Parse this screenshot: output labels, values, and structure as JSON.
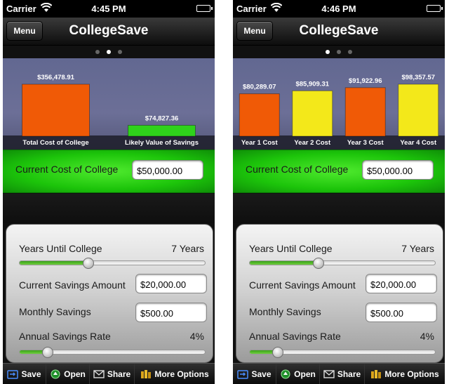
{
  "status": {
    "carrier": "Carrier"
  },
  "navbar": {
    "menu_label": "Menu",
    "title": "CollegeSave"
  },
  "cost_of_college": {
    "label": "Current Cost of College",
    "value": "$50,000.00"
  },
  "form": {
    "years_label": "Years Until College",
    "years_value": "7 Years",
    "years_slider_fraction": 0.37,
    "savings_label": "Current Savings Amount",
    "savings_value": "$20,000.00",
    "monthly_label": "Monthly Savings",
    "monthly_value": "$500.00",
    "rate_label": "Annual Savings Rate",
    "rate_value": "4%",
    "rate_slider_fraction": 0.15
  },
  "tabbar": {
    "save": "Save",
    "open": "Open",
    "share": "Share",
    "more": "More Options"
  },
  "colors": {
    "bar_orange": "#f05a06",
    "bar_yellow": "#f3e81a",
    "bar_green": "#2fd21b",
    "panel_green": "#1cc40a"
  },
  "screens": [
    {
      "time": "4:45 PM",
      "page_dots_total": 3,
      "page_dot_active": 1,
      "chart_data": {
        "type": "bar",
        "categories": [
          "Total Cost of College",
          "Likely Value of Savings"
        ],
        "values": [
          356478.91,
          74827.36
        ],
        "value_labels": [
          "$356,478.91",
          "$74,827.36"
        ],
        "colors": [
          "#f05a06",
          "#2fd21b"
        ],
        "ylim": [
          0,
          356478.91
        ]
      }
    },
    {
      "time": "4:46 PM",
      "page_dots_total": 3,
      "page_dot_active": 0,
      "chart_data": {
        "type": "bar",
        "categories": [
          "Year 1 Cost",
          "Year 2 Cost",
          "Year 3 Cost",
          "Year 4 Cost"
        ],
        "values": [
          80289.07,
          85909.31,
          91922.96,
          98357.57
        ],
        "value_labels": [
          "$80,289.07",
          "$85,909.31",
          "$91,922.96",
          "$98,357.57"
        ],
        "colors": [
          "#f05a06",
          "#f3e81a",
          "#f05a06",
          "#f3e81a"
        ],
        "ylim": [
          0,
          98357.57
        ]
      }
    }
  ]
}
